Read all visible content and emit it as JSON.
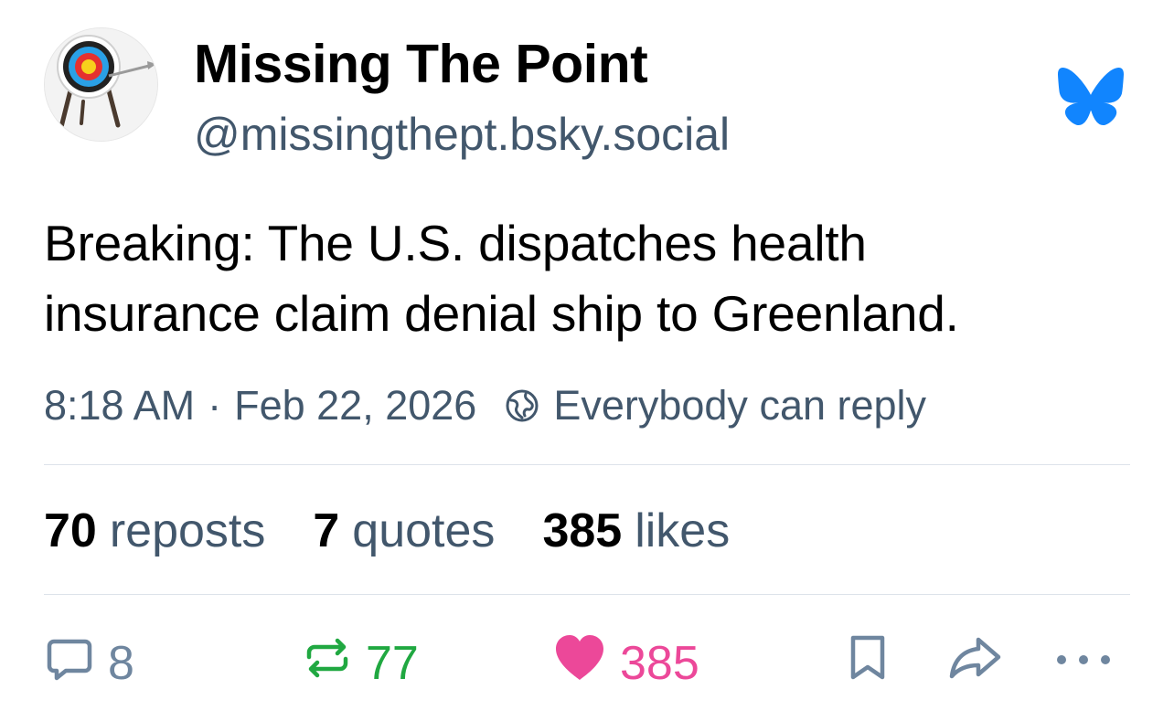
{
  "author": {
    "display_name": "Missing The Point",
    "handle": "@missingthept.bsky.social",
    "avatar_icon": "archery-target-icon"
  },
  "post": {
    "text_lines": [
      "Breaking: The U.S. dispatches health",
      "insurance claim denial ship to Greenland."
    ]
  },
  "meta": {
    "time": "8:18 AM",
    "separator": "·",
    "date": "Feb 22, 2026",
    "reply_setting": "Everybody can reply",
    "reply_setting_icon": "globe-icon"
  },
  "stats": {
    "reposts_count": "70",
    "reposts_label": "reposts",
    "quotes_count": "7",
    "quotes_label": "quotes",
    "likes_count": "385",
    "likes_label": "likes"
  },
  "actions": {
    "reply_count": "8",
    "repost_count": "77",
    "like_count": "385",
    "icons": [
      "reply-icon",
      "repost-icon",
      "heart-icon",
      "bookmark-icon",
      "share-icon",
      "more-icon"
    ]
  },
  "colors": {
    "muted_text": "#42576c",
    "icon_gray": "#6f869f",
    "repost_green": "#20a841",
    "like_pink": "#ec4899",
    "bluesky_blue": "#1185fe",
    "divider": "#dde3ea"
  },
  "brand": {
    "logo_icon": "bluesky-butterfly-icon"
  }
}
